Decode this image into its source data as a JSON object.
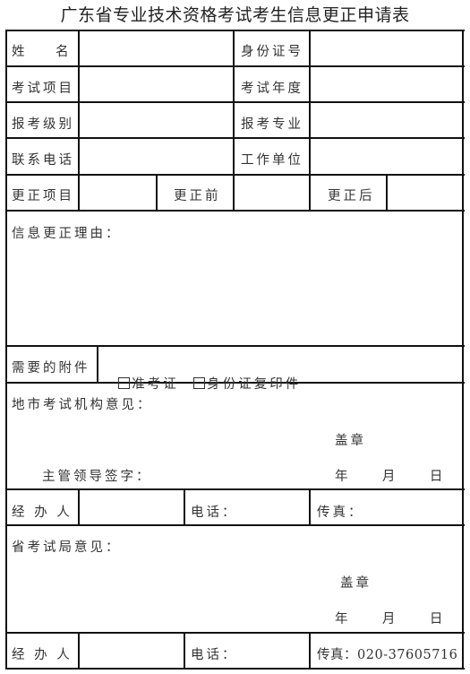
{
  "title": "广东省专业技术资格考试考生信息更正申请表",
  "rows": {
    "name_label": "姓      名",
    "id_label": "身份证号",
    "exam_item_label": "考试项目",
    "exam_year_label": "考试年度",
    "level_label": "报考级别",
    "major_label": "报考专业",
    "phone_label": "联系电话",
    "workplace_label": "工作单位",
    "correction_item_label": "更正项目",
    "before_label": "更正前",
    "after_label": "更正后"
  },
  "reason": {
    "label": "信息更正理由："
  },
  "attachments": {
    "label": "需要的附件",
    "options": [
      {
        "label": "准考证",
        "checked": false
      },
      {
        "label": "身份证复印件",
        "checked": false
      }
    ]
  },
  "city_opinion": {
    "label": "地市考试机构意见：",
    "seal": "盖章",
    "signature": "主管领导签字：",
    "date": "年    月    日"
  },
  "city_handler": {
    "handler_label": "经 办 人",
    "phone_label": "电话：",
    "fax_label": "传真："
  },
  "province_opinion": {
    "label": "省考试局意见：",
    "seal": "盖章",
    "date": "年    月    日"
  },
  "province_handler": {
    "handler_label": "经 办 人",
    "phone_label": "电话：",
    "fax_label": "传真：020-37605716"
  }
}
